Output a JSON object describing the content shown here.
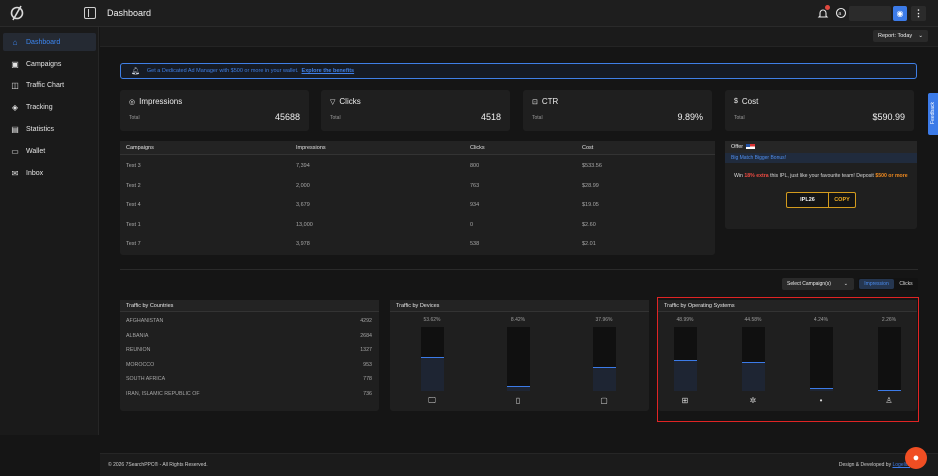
{
  "header": {
    "title": "Dashboard",
    "report_label": "Report: Today"
  },
  "sidebar": {
    "items": [
      {
        "label": "Dashboard",
        "icon": "home-icon",
        "active": true
      },
      {
        "label": "Campaigns",
        "icon": "campaign-icon"
      },
      {
        "label": "Traffic Chart",
        "icon": "chart-icon"
      },
      {
        "label": "Tracking",
        "icon": "tracking-icon"
      },
      {
        "label": "Statistics",
        "icon": "statistics-icon"
      },
      {
        "label": "Wallet",
        "icon": "wallet-icon"
      },
      {
        "label": "Inbox",
        "icon": "inbox-icon"
      }
    ]
  },
  "banner": {
    "text": "Get a Dedicated Ad Manager with $500 or more in your wallet.",
    "link": "Explore the benefits"
  },
  "stats": [
    {
      "title": "Impressions",
      "sub": "Total",
      "value": "45688",
      "icon": "eye-icon"
    },
    {
      "title": "Clicks",
      "sub": "Total",
      "value": "4518",
      "icon": "cursor-icon"
    },
    {
      "title": "CTR",
      "sub": "Total",
      "value": "9.89%",
      "icon": "ctr-icon"
    },
    {
      "title": "Cost",
      "sub": "Total",
      "value": "$590.99",
      "icon": "cost-icon"
    }
  ],
  "campaign_table": {
    "columns": [
      "Campaigns",
      "Impressions",
      "Clicks",
      "Cost"
    ],
    "rows": [
      [
        "Test 3",
        "7,394",
        "800",
        "$533.56"
      ],
      [
        "Test 2",
        "2,000",
        "763",
        "$28.99"
      ],
      [
        "Test 4",
        "3,679",
        "934",
        "$19.05"
      ],
      [
        "Test 1",
        "13,000",
        "0",
        "$2.60"
      ],
      [
        "Test 7",
        "3,978",
        "538",
        "$2.01"
      ]
    ]
  },
  "offer": {
    "title": "Offer",
    "subtitle": "Big Match Bigger Bonus!",
    "text_pre": "Win",
    "text_highlight": "18% extra",
    "text_mid": "this IPL, just like your favourite team! Deposit",
    "text_amount": "$500 or more",
    "code": "IPL26",
    "copy_label": "COPY"
  },
  "filters": {
    "select_label": "Select Campaign(s)",
    "toggle_on": "Impression",
    "toggle_off": "Clicks"
  },
  "countries": {
    "title": "Traffic by Countries",
    "rows": [
      {
        "name": "AFGHANISTAN",
        "value": "4292"
      },
      {
        "name": "ALBANIA",
        "value": "2684"
      },
      {
        "name": "REUNION",
        "value": "1327"
      },
      {
        "name": "MOROCCO",
        "value": "953"
      },
      {
        "name": "SOUTH AFRICA",
        "value": "778"
      },
      {
        "name": "IRAN, ISLAMIC REPUBLIC OF",
        "value": "736"
      }
    ]
  },
  "devices": {
    "title": "Traffic by Devices",
    "items": [
      {
        "pct": "53.62%",
        "level": 0.5362,
        "icon": "desktop-icon"
      },
      {
        "pct": "8.42%",
        "level": 0.0842,
        "icon": "tablet-icon"
      },
      {
        "pct": "37.96%",
        "level": 0.3796,
        "icon": "mobile-icon"
      }
    ]
  },
  "os": {
    "title": "Traffic by Operating Systems",
    "items": [
      {
        "pct": "48.99%",
        "level": 0.4899,
        "icon": "windows-icon"
      },
      {
        "pct": "44.58%",
        "level": 0.4458,
        "icon": "android-icon"
      },
      {
        "pct": "4.24%",
        "level": 0.0424,
        "icon": "apple-icon"
      },
      {
        "pct": "2.26%",
        "level": 0.0226,
        "icon": "linux-icon"
      }
    ]
  },
  "footer": {
    "left": "© 2026 7SearchPPC® - All Rights Reserved.",
    "right_prefix": "Design & Developed by",
    "right_brand": "Logelite"
  },
  "feedback_label": "Feedback",
  "colors": {
    "accent": "#3c7be8",
    "highlight_border": "#e02424",
    "offer_gold": "#d39b1e"
  }
}
